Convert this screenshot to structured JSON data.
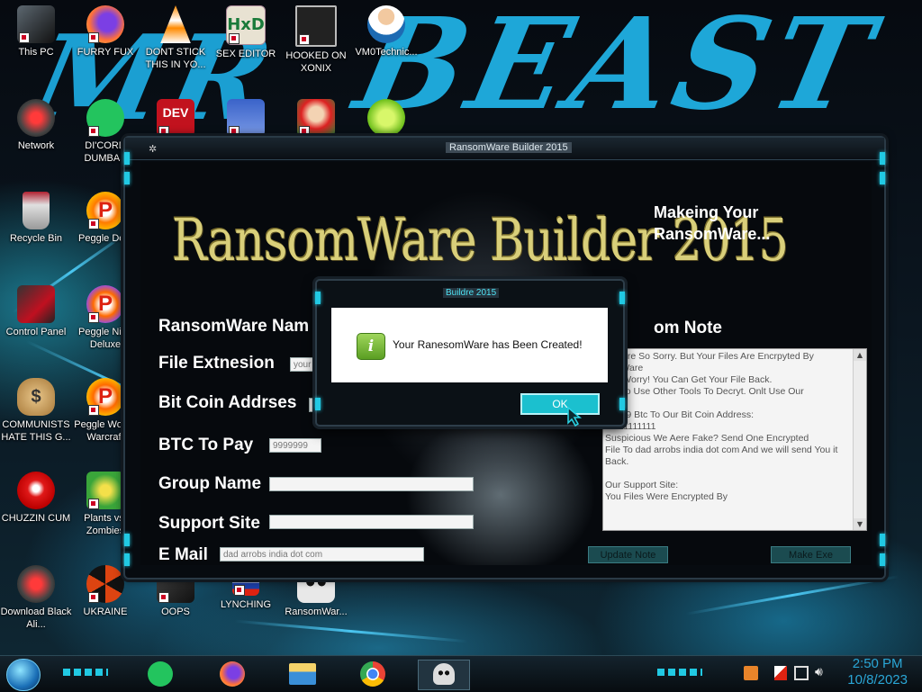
{
  "desktop_icons": [
    {
      "label": "This PC",
      "icon": "computer-icon"
    },
    {
      "label": "FURRY FUX",
      "icon": "firefox-icon"
    },
    {
      "label": "DONT STICK THIS IN YO...",
      "icon": "vlc-cone-icon"
    },
    {
      "label": "SEX EDITOR",
      "icon": "hxd-editor-icon"
    },
    {
      "label": "HOOKED ON XONIX",
      "icon": "xonix-game-icon"
    },
    {
      "label": "VM0Technic...",
      "icon": "doctor-person-icon"
    },
    {
      "label": "Network",
      "icon": "network-orb-icon"
    },
    {
      "label": "DI'CORD DUMBAS",
      "icon": "chat-app-icon"
    },
    {
      "label": "",
      "icon": "dev-app-icon"
    },
    {
      "label": "",
      "icon": "card-app-icon"
    },
    {
      "label": "",
      "icon": "santa-game-icon"
    },
    {
      "label": "",
      "icon": "lime-app-icon"
    },
    {
      "label": "Recycle Bin",
      "icon": "recycle-bin-icon"
    },
    {
      "label": "Peggle Delu",
      "icon": "peggle-icon"
    },
    {
      "label": "Control Panel",
      "icon": "control-panel-icon"
    },
    {
      "label": "Peggle Nigh Deluxe",
      "icon": "peggle-icon"
    },
    {
      "label": "COMMUNISTS HATE THIS G...",
      "icon": "money-bag-icon"
    },
    {
      "label": "Peggle Wor of Warcraft",
      "icon": "peggle-icon"
    },
    {
      "label": "CHUZZIN CUM",
      "icon": "chuzzle-icon"
    },
    {
      "label": "Plants vs. Zombies",
      "icon": "plants-icon"
    },
    {
      "label": "Download Black Ali...",
      "icon": "network-orb-icon"
    },
    {
      "label": "UKRAINE",
      "icon": "radiation-icon"
    },
    {
      "label": "OOPS",
      "icon": "device-icon"
    },
    {
      "label": "LYNCHING",
      "icon": "flag-icon"
    },
    {
      "label": "RansomWar...",
      "icon": "skull-icon"
    }
  ],
  "builder": {
    "window_title": "RansomWare Builder 2015",
    "banner": "RansomWare Builder 2015",
    "status": "Makeing Your RansomWare...",
    "fields": [
      {
        "label": "RansomWare Nam",
        "value": ""
      },
      {
        "label": "File Extnesion",
        "value": "your"
      },
      {
        "label": "Bit Coin Addrses",
        "value": "1"
      },
      {
        "label": "BTC To Pay",
        "value": "9999999"
      },
      {
        "label": "Group Name",
        "value": ""
      },
      {
        "label": "Support Site",
        "value": ""
      },
      {
        "label": "E Mail",
        "value": "dad arrobs india dot com"
      }
    ],
    "note_label": "om Note",
    "note_text": "We Are So Sorry. But Your Files Are Encrpyted By\nom Ware\nNot Worry! You Can Get Your File Back.\nTry To Use Other Tools To Decryt. Onlt Use Our\n\n99999 Btc To Our Bit Coin Address:\n11111111111\nSuspicious We Aere Fake? Send One Encrypted\nFile To dad arrobs india dot com And we will send You it\nBack.\n\nOur Support Site:\nYou Files Were Encrypted By",
    "update_button": "Update Note",
    "make_button": "Make Exe"
  },
  "dialog": {
    "title": "Buildre 2015",
    "message": "Your RanesomWare has Been Created!",
    "ok_label": "OK"
  },
  "taskbar": {
    "apps": [
      "chat-app-icon",
      "firefox-icon",
      "file-explorer-icon",
      "chrome-icon",
      "skull-icon"
    ],
    "tray": [
      "fire-icon",
      "flag-x-icon",
      "network-icon",
      "volume-icon"
    ],
    "time": "2:50 PM",
    "date": "10/8/2023"
  }
}
